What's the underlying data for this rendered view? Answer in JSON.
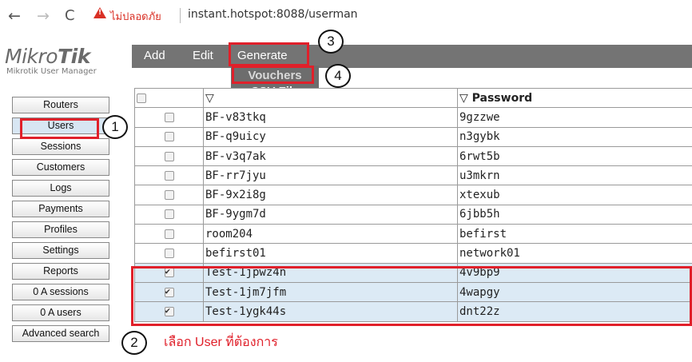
{
  "browser": {
    "back": "←",
    "forward": "→",
    "reload": "C",
    "security_label": "ไม่ปลอดภัย",
    "url": "instant.hotspot:8088/userman"
  },
  "app": {
    "logo_light": "Mikro",
    "logo_bold": "Tik",
    "subtitle": "Mikrotik User Manager"
  },
  "sidebar": {
    "items": [
      {
        "label": "Routers"
      },
      {
        "label": "Users"
      },
      {
        "label": "Sessions"
      },
      {
        "label": "Customers"
      },
      {
        "label": "Logs"
      },
      {
        "label": "Payments"
      },
      {
        "label": "Profiles"
      },
      {
        "label": "Settings"
      },
      {
        "label": "Reports"
      },
      {
        "label": "0 A sessions"
      },
      {
        "label": "0 A users"
      },
      {
        "label": "Advanced search"
      }
    ]
  },
  "menu": {
    "add": "Add",
    "edit": "Edit",
    "generate": "Generate",
    "generate_items": [
      "Vouchers",
      "CSV File"
    ]
  },
  "table": {
    "header": {
      "col1": "▽",
      "col2": "▽ Password"
    },
    "rows": [
      {
        "username": "BF-v83tkq",
        "password": "9gzzwe",
        "checked": false
      },
      {
        "username": "BF-q9uicy",
        "password": "n3gybk",
        "checked": false
      },
      {
        "username": "BF-v3q7ak",
        "password": "6rwt5b",
        "checked": false
      },
      {
        "username": "BF-rr7jyu",
        "password": "u3mkrn",
        "checked": false
      },
      {
        "username": "BF-9x2i8g",
        "password": "xtexub",
        "checked": false
      },
      {
        "username": "BF-9ygm7d",
        "password": "6jbb5h",
        "checked": false
      },
      {
        "username": "room204",
        "password": "befirst",
        "checked": false
      },
      {
        "username": "befirst01",
        "password": "network01",
        "checked": false
      },
      {
        "username": "Test-1jpwz4n",
        "password": "4v9bp9",
        "checked": true
      },
      {
        "username": "Test-1jm7jfm",
        "password": "4wapgy",
        "checked": true
      },
      {
        "username": "Test-1ygk44s",
        "password": "dnt22z",
        "checked": true
      }
    ]
  },
  "annotations": {
    "steps": [
      "1",
      "2",
      "3",
      "4"
    ],
    "note": "เลือก   User ที่ต้องการ",
    "color": "#e0202a"
  }
}
